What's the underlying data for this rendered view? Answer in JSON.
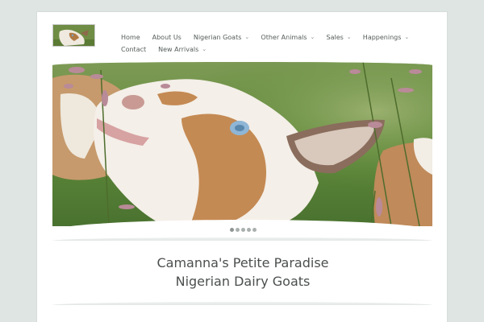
{
  "site": {
    "title_line1": "Camanna's Petite Paradise",
    "title_line2": "Nigerian Dairy Goats"
  },
  "nav": {
    "items": [
      {
        "label": "Home",
        "has_dropdown": false
      },
      {
        "label": "About Us",
        "has_dropdown": false
      },
      {
        "label": "Nigerian Goats",
        "has_dropdown": true
      },
      {
        "label": "Other Animals",
        "has_dropdown": true
      },
      {
        "label": "Sales",
        "has_dropdown": true
      },
      {
        "label": "Happenings",
        "has_dropdown": true
      },
      {
        "label": "Contact",
        "has_dropdown": false
      },
      {
        "label": "New Arrivals",
        "has_dropdown": true
      }
    ],
    "dropdown_icon": "chevron-down-icon"
  },
  "slider": {
    "slide_count": 5,
    "active_index": 0
  },
  "colors": {
    "background": "#dfe5e2",
    "nav_text": "#555d5a",
    "title_text": "#4b4f4d",
    "dot": "#a9b0ad"
  }
}
